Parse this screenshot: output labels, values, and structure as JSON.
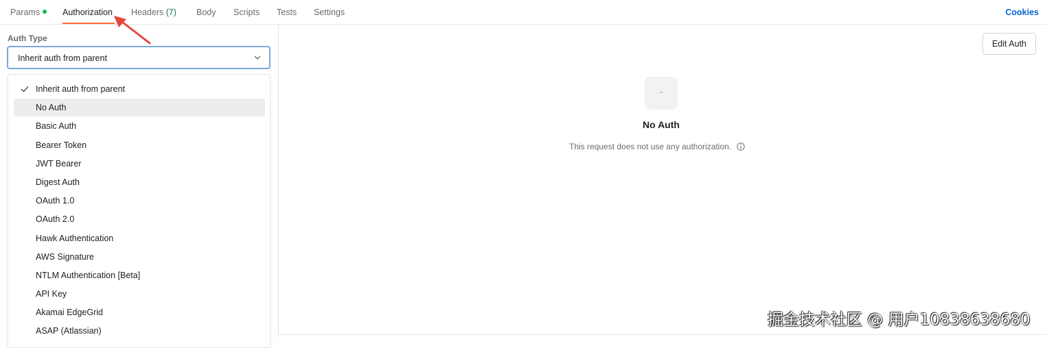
{
  "tabs": {
    "params": "Params",
    "authorization": "Authorization",
    "headers": "Headers",
    "headers_count": "(7)",
    "body": "Body",
    "scripts": "Scripts",
    "tests": "Tests",
    "settings": "Settings",
    "active": "Authorization"
  },
  "cookies": "Cookies",
  "auth": {
    "type_label": "Auth Type",
    "selected": "Inherit auth from parent",
    "hovered": "No Auth",
    "options": [
      "Inherit auth from parent",
      "No Auth",
      "Basic Auth",
      "Bearer Token",
      "JWT Bearer",
      "Digest Auth",
      "OAuth 1.0",
      "OAuth 2.0",
      "Hawk Authentication",
      "AWS Signature",
      "NTLM Authentication [Beta]",
      "API Key",
      "Akamai EdgeGrid",
      "ASAP (Atlassian)"
    ]
  },
  "right": {
    "edit_button": "Edit Auth",
    "icon_glyph": "-",
    "title": "No Auth",
    "description": "This request does not use any authorization."
  },
  "watermark": "掘金技术社区 @ 用户10838638680",
  "colors": {
    "accent": "#ff6c37",
    "link": "#0265d2",
    "params_dot": "#0cbb52",
    "annotation_arrow": "#e8453c"
  },
  "icons": {
    "check": "check-icon",
    "chevron": "chevron-down-icon",
    "info": "info-icon"
  }
}
